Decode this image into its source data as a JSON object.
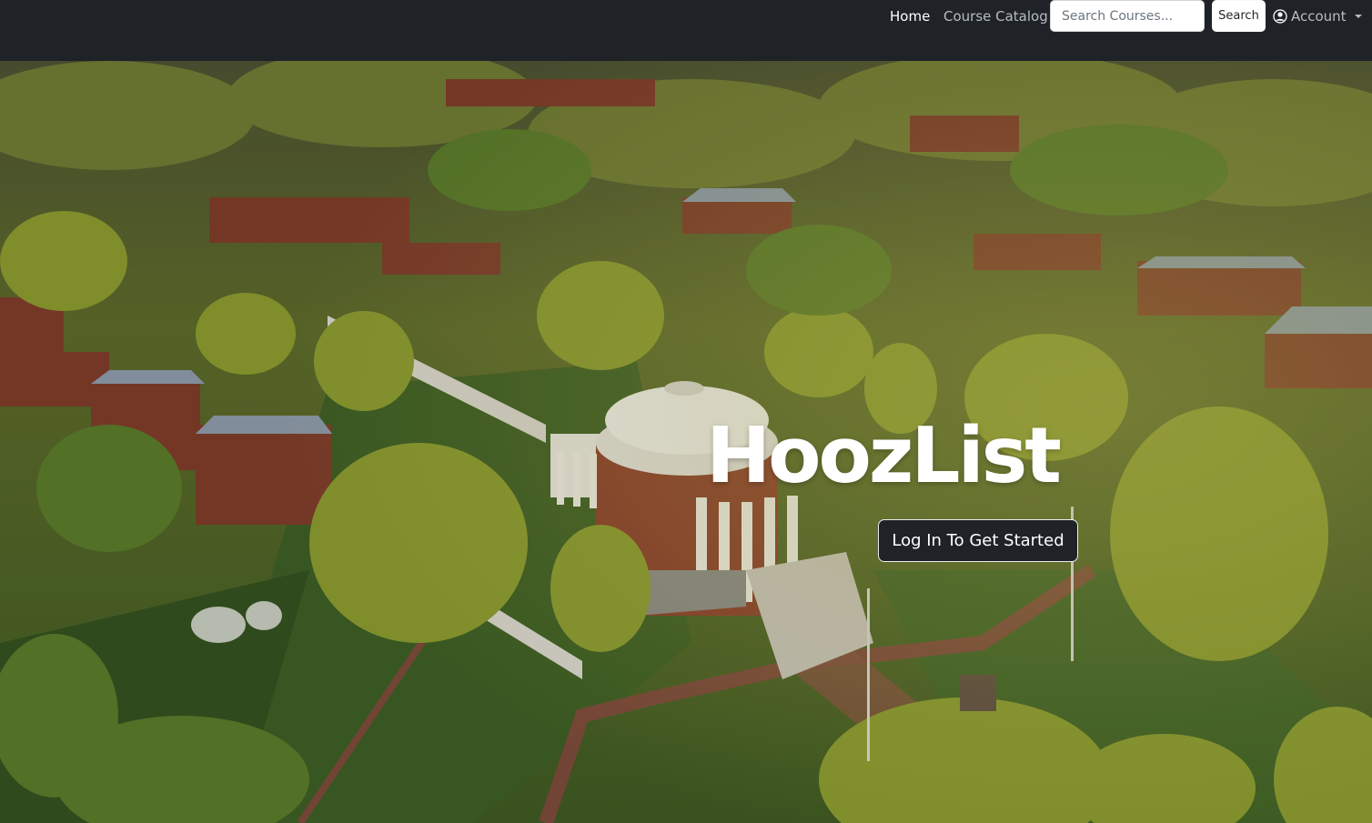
{
  "navbar": {
    "home_label": "Home",
    "catalog_label": "Course Catalog",
    "search_placeholder": "Search Courses...",
    "search_value": "",
    "search_button_label": "Search",
    "account_label": "Account"
  },
  "hero": {
    "title": "HoozList",
    "cta_label": "Log In To Get Started"
  },
  "icons": {
    "account": "person-circle-icon",
    "account_menu": "caret-down-icon"
  },
  "colors": {
    "navbar_bg": "#1f2328",
    "button_dark": "#1f2328",
    "text_light": "#ffffff",
    "text_muted": "#b7bcc2"
  }
}
